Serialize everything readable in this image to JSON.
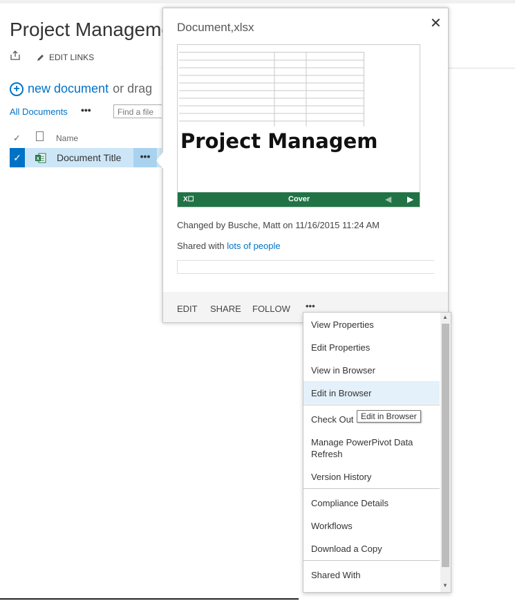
{
  "page": {
    "title": "Project Manageme",
    "edit_links": "EDIT LINKS",
    "new_document_link": "new document",
    "new_document_rest": "or drag",
    "view": "All Documents",
    "view_menu": "•••",
    "find_placeholder": "Find a file"
  },
  "list": {
    "header_name": "Name",
    "row": {
      "title": "Document Title",
      "ellipsis": "•••"
    }
  },
  "callout": {
    "title": "Document,xlsx",
    "close": "✕",
    "preview": {
      "heading": "Project Managem",
      "sheet": "Cover"
    },
    "changed_by": "Changed by Busche, Matt on 11/16/2015 11:24 AM",
    "shared_prefix": "Shared with",
    "shared_link": "lots of people",
    "actions": [
      "EDIT",
      "SHARE",
      "FOLLOW",
      "•••"
    ]
  },
  "menu": {
    "items": [
      "View Properties",
      "Edit Properties",
      "View in Browser",
      "Edit in Browser",
      "Check Out",
      "Manage PowerPivot Data Refresh",
      "Version History",
      "Compliance Details",
      "Workflows",
      "Download a Copy",
      "Shared With"
    ],
    "highlighted": "Edit in Browser",
    "tooltip": "Edit in Browser"
  },
  "colors": {
    "link": "#0072c6",
    "excel_green": "#217346",
    "selection": "#cde6f7"
  }
}
